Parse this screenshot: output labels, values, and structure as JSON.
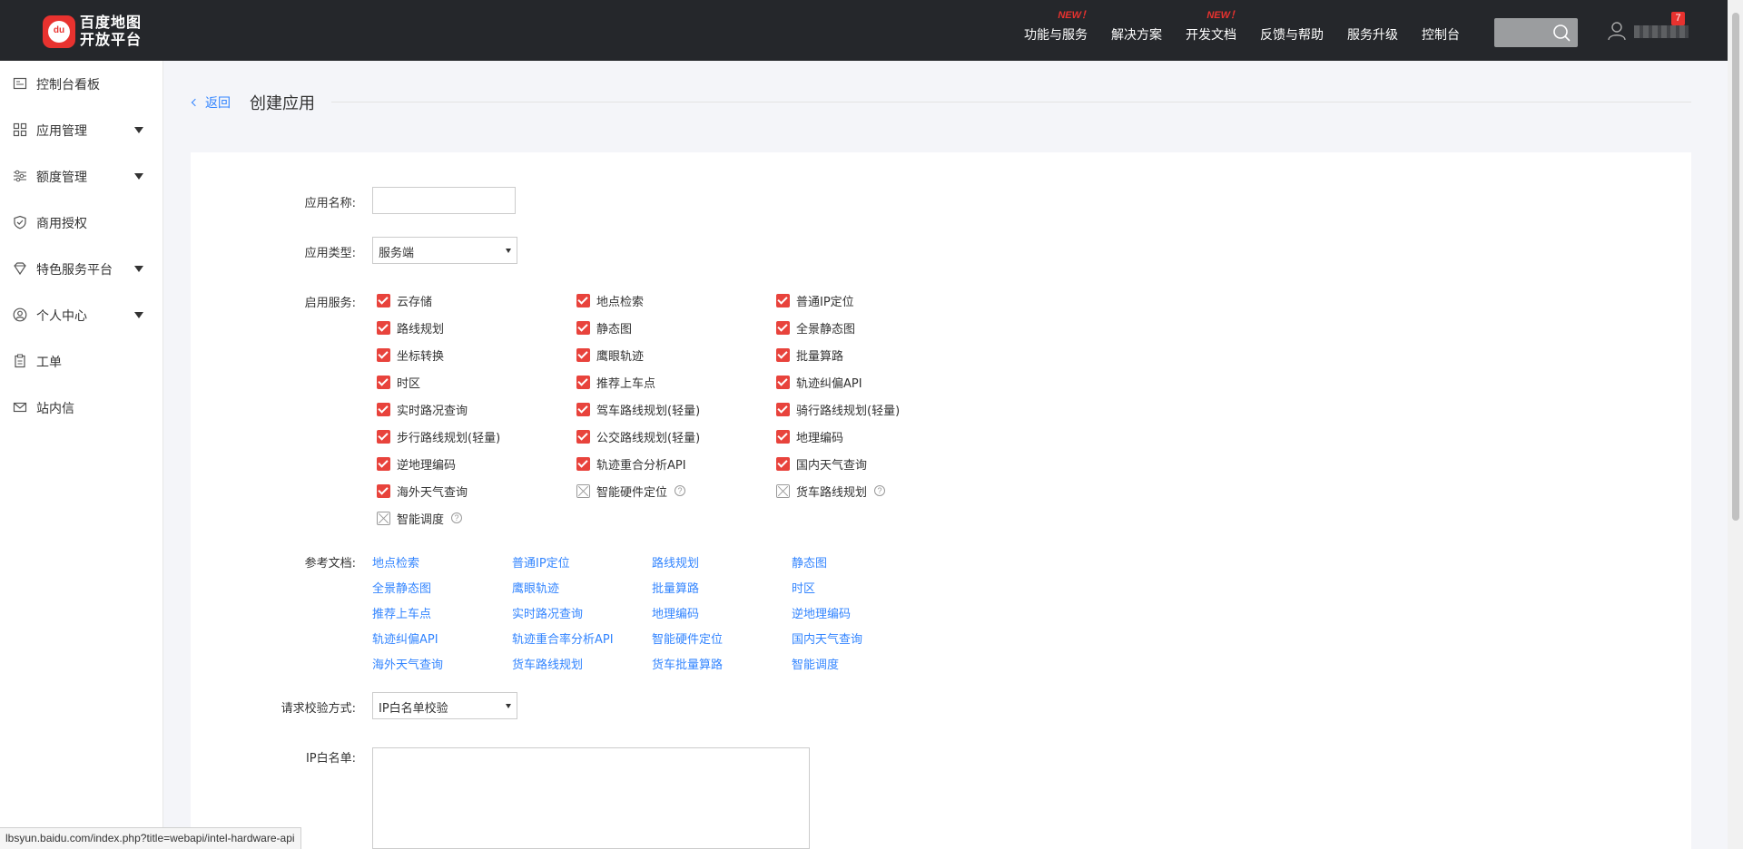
{
  "header": {
    "logo": {
      "badge": "du",
      "line1": "百度地图",
      "line2": "开放平台"
    },
    "nav": [
      {
        "label": "功能与服务",
        "tag": "NEW！"
      },
      {
        "label": "解决方案",
        "tag": ""
      },
      {
        "label": "开发文档",
        "tag": "NEW！"
      },
      {
        "label": "反馈与帮助",
        "tag": ""
      },
      {
        "label": "服务升级",
        "tag": ""
      },
      {
        "label": "控制台",
        "tag": ""
      }
    ],
    "notification_count": "7"
  },
  "sidebar": {
    "items": [
      {
        "label": "控制台看板",
        "icon": "dashboard-icon"
      },
      {
        "label": "应用管理",
        "icon": "grid-icon"
      },
      {
        "label": "额度管理",
        "icon": "sliders-icon"
      },
      {
        "label": "商用授权",
        "icon": "shield-check-icon"
      },
      {
        "label": "特色服务平台",
        "icon": "diamond-icon"
      },
      {
        "label": "个人中心",
        "icon": "user-circle-icon"
      },
      {
        "label": "工单",
        "icon": "clipboard-icon"
      },
      {
        "label": "站内信",
        "icon": "mail-icon"
      }
    ]
  },
  "page": {
    "back_label": "返回",
    "title": "创建应用"
  },
  "form": {
    "name_label": "应用名称:",
    "name_value": "",
    "type_label": "应用类型:",
    "type_value": "服务端",
    "services_label": "启用服务:",
    "services": [
      {
        "label": "云存储",
        "checked": true
      },
      {
        "label": "地点检索",
        "checked": true
      },
      {
        "label": "普通IP定位",
        "checked": true
      },
      {
        "label": "路线规划",
        "checked": true
      },
      {
        "label": "静态图",
        "checked": true
      },
      {
        "label": "全景静态图",
        "checked": true
      },
      {
        "label": "坐标转换",
        "checked": true
      },
      {
        "label": "鹰眼轨迹",
        "checked": true
      },
      {
        "label": "批量算路",
        "checked": true
      },
      {
        "label": "时区",
        "checked": true
      },
      {
        "label": "推荐上车点",
        "checked": true
      },
      {
        "label": "轨迹纠偏API",
        "checked": true
      },
      {
        "label": "实时路况查询",
        "checked": true
      },
      {
        "label": "驾车路线规划(轻量)",
        "checked": true
      },
      {
        "label": "骑行路线规划(轻量)",
        "checked": true
      },
      {
        "label": "步行路线规划(轻量)",
        "checked": true
      },
      {
        "label": "公交路线规划(轻量)",
        "checked": true
      },
      {
        "label": "地理编码",
        "checked": true
      },
      {
        "label": "逆地理编码",
        "checked": true
      },
      {
        "label": "轨迹重合分析API",
        "checked": true
      },
      {
        "label": "国内天气查询",
        "checked": true
      },
      {
        "label": "海外天气查询",
        "checked": true
      },
      {
        "label": "智能硬件定位",
        "checked": false
      },
      {
        "label": "货车路线规划",
        "checked": false
      },
      {
        "label": "智能调度",
        "checked": false
      }
    ],
    "help_glyph": "?",
    "docs_label": "参考文档:",
    "docs": [
      "地点检索",
      "普通IP定位",
      "路线规划",
      "静态图",
      "全景静态图",
      "鹰眼轨迹",
      "批量算路",
      "时区",
      "推荐上车点",
      "实时路况查询",
      "地理编码",
      "逆地理编码",
      "轨迹纠偏API",
      "轨迹重合率分析API",
      "智能硬件定位",
      "国内天气查询",
      "海外天气查询",
      "货车路线规划",
      "货车批量算路",
      "智能调度"
    ],
    "verify_label": "请求校验方式:",
    "verify_value": "IP白名单校验",
    "whitelist_label": "IP白名单:",
    "whitelist_value": ""
  },
  "status_url": "lbsyun.baidu.com/index.php?title=webapi/intel-hardware-api",
  "colors": {
    "accent_red": "#e8433c",
    "link_blue": "#3385ff",
    "header_bg": "#25272b"
  }
}
